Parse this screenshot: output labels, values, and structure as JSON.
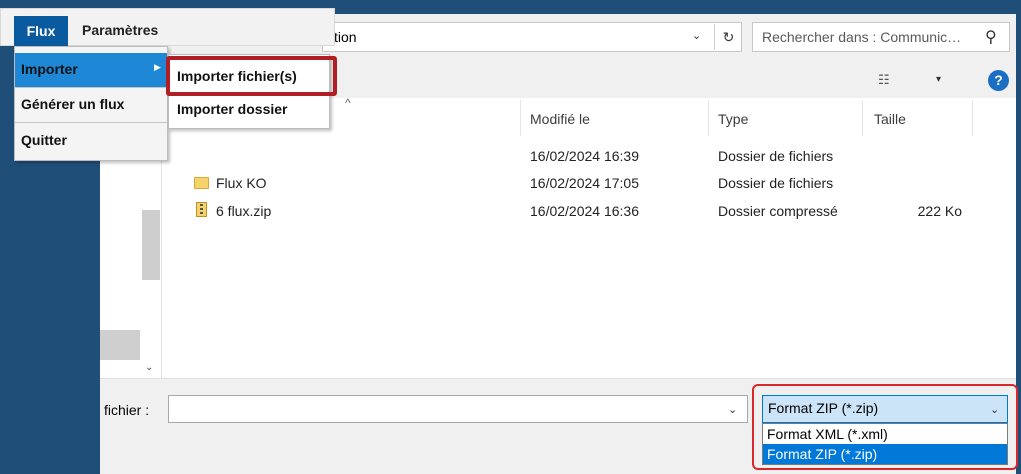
{
  "address_bar": {
    "path_fragment": "tion"
  },
  "search": {
    "placeholder": "Rechercher dans : Communic…"
  },
  "icons": {
    "dropdown": "▾",
    "chevron": "⌄",
    "refresh": "↻",
    "search": "⚲",
    "view": "☷",
    "help": "?",
    "scroll_down": "⌄",
    "submenu_arrow": "▶",
    "sort": "^"
  },
  "file_list": {
    "columns": [
      "Modifié le",
      "Type",
      "Taille"
    ],
    "rows": [
      {
        "name": "",
        "date": "16/02/2024 16:39",
        "type": "Dossier de fichiers",
        "size": ""
      },
      {
        "name": "Flux KO",
        "date": "16/02/2024 17:05",
        "type": "Dossier de fichiers",
        "size": ""
      },
      {
        "name": "6 flux.zip",
        "date": "16/02/2024 16:36",
        "type": "Dossier compressé",
        "size": "222 Ko"
      }
    ]
  },
  "footer": {
    "filename_label": "fichier :",
    "filename_value": "",
    "filter_selected": "Format ZIP (*.zip)",
    "filter_options": [
      "Format XML (*.xml)",
      "Format ZIP (*.zip)"
    ]
  },
  "app_menu": {
    "menubar": [
      "Flux",
      "Paramètres"
    ],
    "items": [
      "Importer",
      "Générer un flux",
      "Quitter"
    ],
    "submenu": [
      "Importer fichier(s)",
      "Importer dossier"
    ]
  },
  "colors": {
    "desktop_bg": "#1f4e79",
    "menu_active": "#1e88d6",
    "menu_flux_bg": "#0a5aa0",
    "highlight_red": "#b11e23",
    "selection_blue": "#0078d7"
  }
}
